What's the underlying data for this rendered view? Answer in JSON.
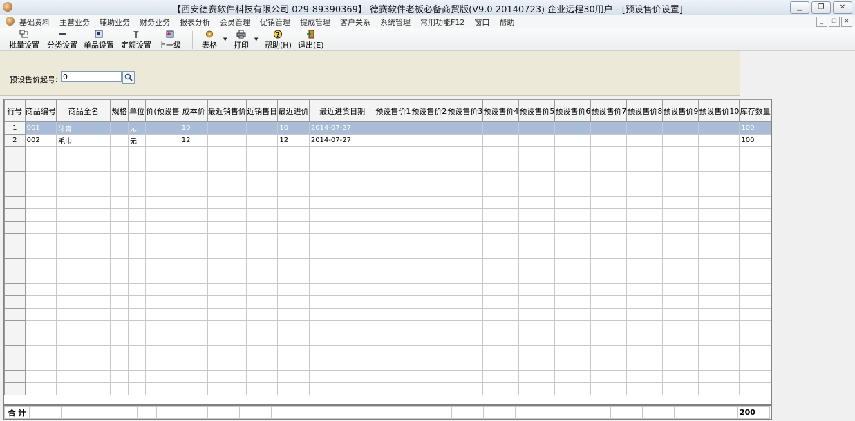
{
  "window": {
    "title": "【西安德赛软件科技有限公司 029-89390369】 德赛软件老板必备商贸版(V9.0 20140723) 企业远程30用户 - [预设售价设置]"
  },
  "menu": [
    "基础资料",
    "主营业务",
    "辅助业务",
    "财务业务",
    "报表分析",
    "会员管理",
    "促销管理",
    "提成管理",
    "客户关系",
    "系统管理",
    "常用功能F12",
    "窗口",
    "帮助"
  ],
  "toolbar": {
    "batch": "批量设置",
    "category": "分类设置",
    "single": "单品设置",
    "quota": "定额设置",
    "up": "上一级",
    "table": "表格",
    "print": "打印",
    "help": "帮助(H)",
    "exit": "退出(E)"
  },
  "filter": {
    "label": "预设售价起号:",
    "value": "0"
  },
  "grid": {
    "columns": [
      "行号",
      "商品编号",
      "商品全名",
      "规格",
      "单位",
      "价(预设售",
      "成本价",
      "最近销售价",
      "近销售日",
      "最近进价",
      "最近进货日期",
      "预设售价1",
      "预设售价2",
      "预设售价3",
      "预设售价4",
      "预设售价5",
      "预设售价6",
      "预设售价7",
      "预设售价8",
      "预设售价9",
      "预设售价10",
      "库存数量"
    ],
    "rows": [
      [
        "1",
        "001",
        "牙膏",
        "",
        "无",
        "",
        "10",
        "",
        "",
        "10",
        "2014-07-27",
        "",
        "",
        "",
        "",
        "",
        "",
        "",
        "",
        "",
        "",
        "100"
      ],
      [
        "2",
        "002",
        "毛巾",
        "",
        "无",
        "",
        "12",
        "",
        "",
        "12",
        "2014-07-27",
        "",
        "",
        "",
        "",
        "",
        "",
        "",
        "",
        "",
        "",
        "100"
      ]
    ],
    "selected_row": 0,
    "totals_label": "合 计",
    "totals_stock": "200"
  },
  "colors": {
    "selection": "#a9bcd8",
    "filter_panel": "#ece9d8"
  },
  "icons": [
    "app-logo-icon",
    "batch-set-icon",
    "category-set-icon",
    "single-set-icon",
    "quota-set-icon",
    "up-level-icon",
    "table-gear-icon",
    "printer-icon",
    "help-icon",
    "exit-door-icon",
    "search-icon"
  ]
}
